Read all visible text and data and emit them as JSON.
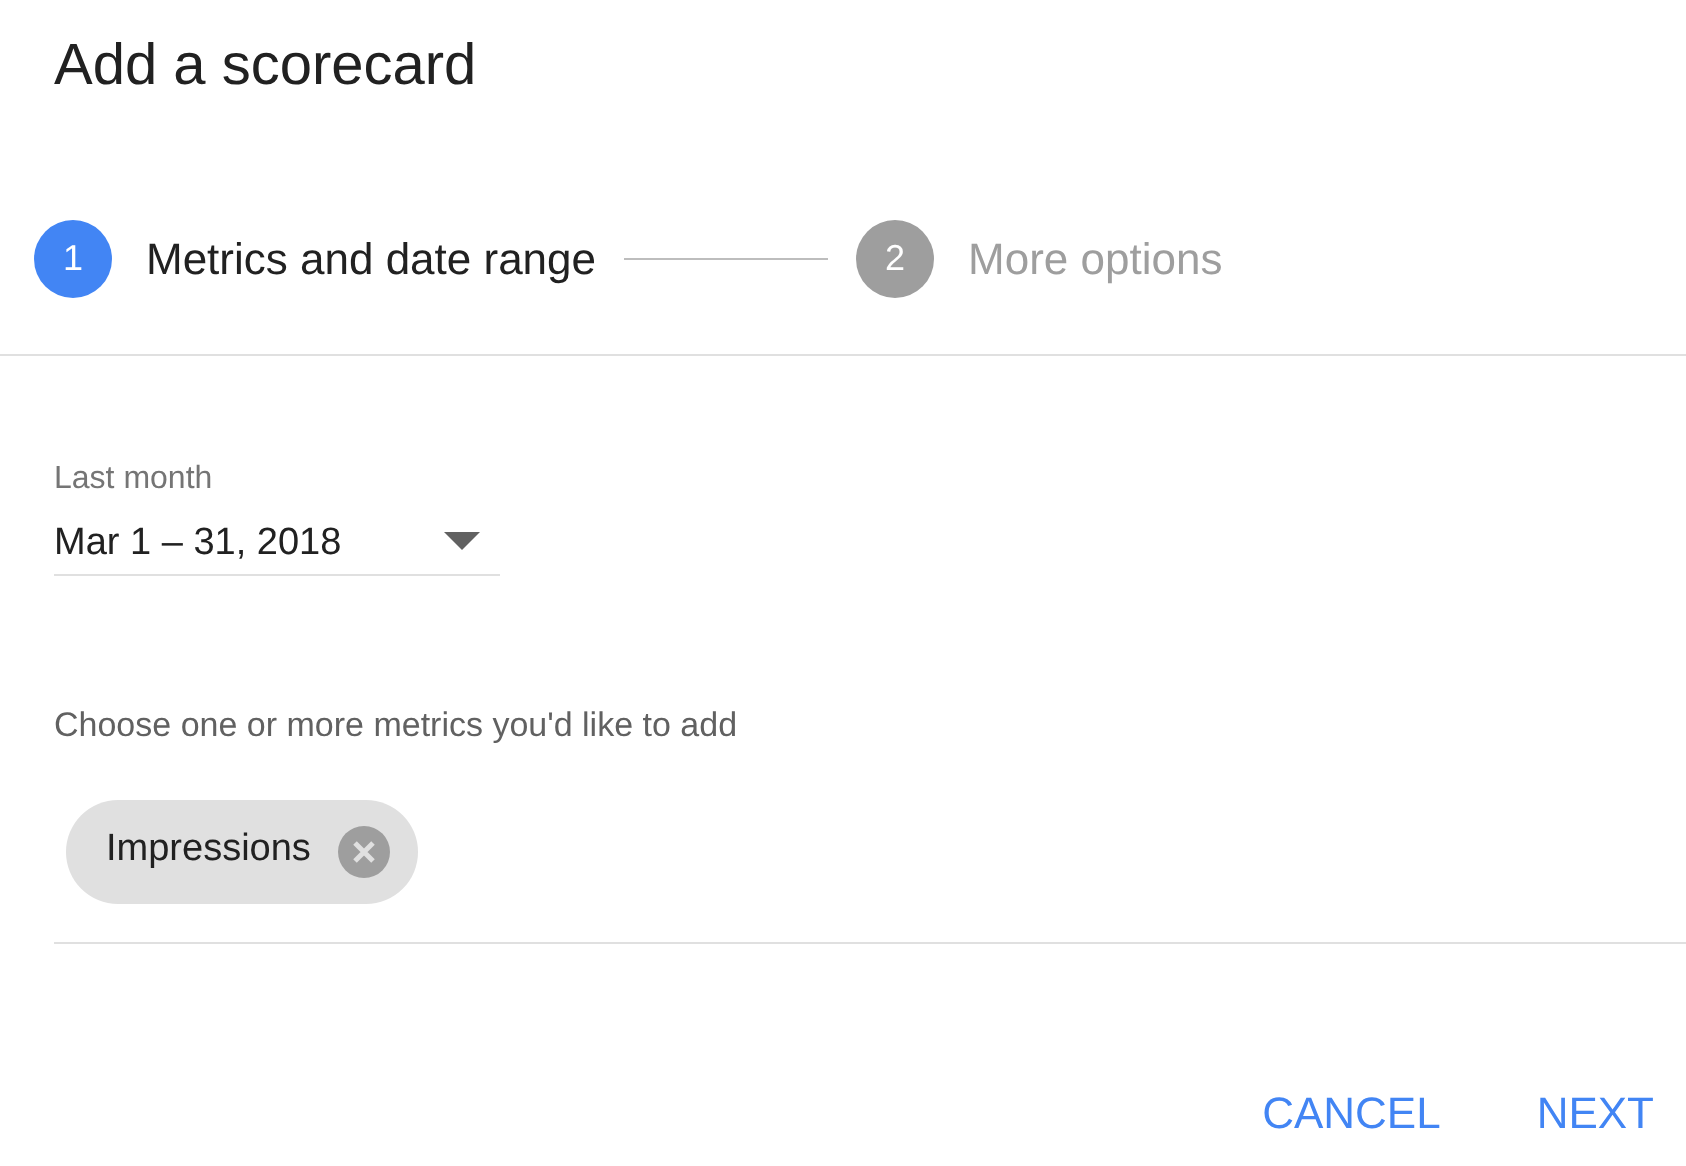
{
  "dialog": {
    "title": "Add a scorecard"
  },
  "steps": [
    {
      "number": "1",
      "label": "Metrics and date range",
      "selected": true
    },
    {
      "number": "2",
      "label": "More options",
      "selected": false
    }
  ],
  "date_range": {
    "label": "Last month",
    "value": "Mar 1 – 31, 2018"
  },
  "metrics": {
    "prompt": "Choose one or more metrics you'd like to add",
    "chips": [
      "Impressions"
    ]
  },
  "buttons": [
    "CANCEL",
    "NEXT"
  ]
}
